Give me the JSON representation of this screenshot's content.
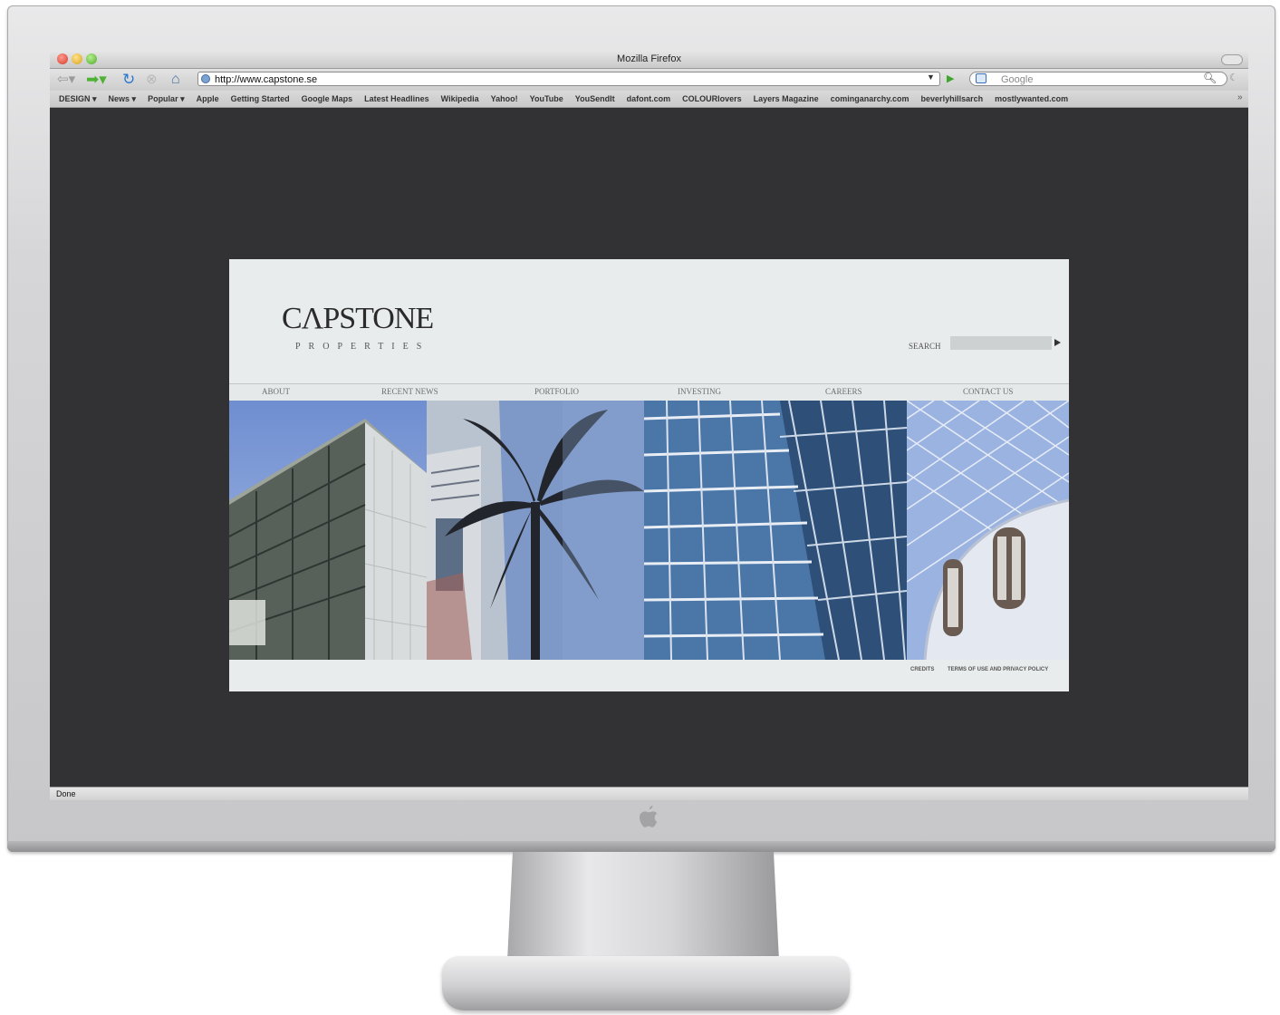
{
  "browser": {
    "window_title": "Mozilla Firefox",
    "url": "http://www.capstone.se",
    "search_placeholder": "Google",
    "status_text": "Done",
    "bookmarks": [
      "DESIGN ▾",
      "News ▾",
      "Popular ▾",
      "Apple",
      "Getting Started",
      "Google Maps",
      "Latest Headlines",
      "Wikipedia",
      "Yahoo!",
      "YouTube",
      "YouSendIt",
      "dafont.com",
      "COLOURlovers",
      "Layers Magazine",
      "cominganarchy.com",
      "beverlyhillsarch",
      "mostlywanted.com"
    ],
    "bookmarks_overflow": "»"
  },
  "site": {
    "logo_text": "CΛPSTONE",
    "logo_sub": "PROPERTIES",
    "search_label": "SEARCH",
    "nav": [
      "ABOUT",
      "RECENT NEWS",
      "PORTFOLIO",
      "INVESTING",
      "CAREERS",
      "CONTACT US"
    ],
    "footer": {
      "credits": "CREDITS",
      "terms": "TERMS OF USE AND PRIVACY POLICY"
    }
  },
  "colors": {
    "screen_bg": "#323234",
    "site_bg": "#e9ecec",
    "sky_blue": "#7f9fd8",
    "glass_blue": "#3f6f9a"
  },
  "icons": [
    "back-arrow-icon",
    "forward-arrow-icon",
    "reload-icon",
    "stop-icon",
    "home-icon",
    "globe-icon",
    "go-arrow-icon",
    "search-engine-icon",
    "magnifier-icon",
    "apple-logo-icon"
  ]
}
